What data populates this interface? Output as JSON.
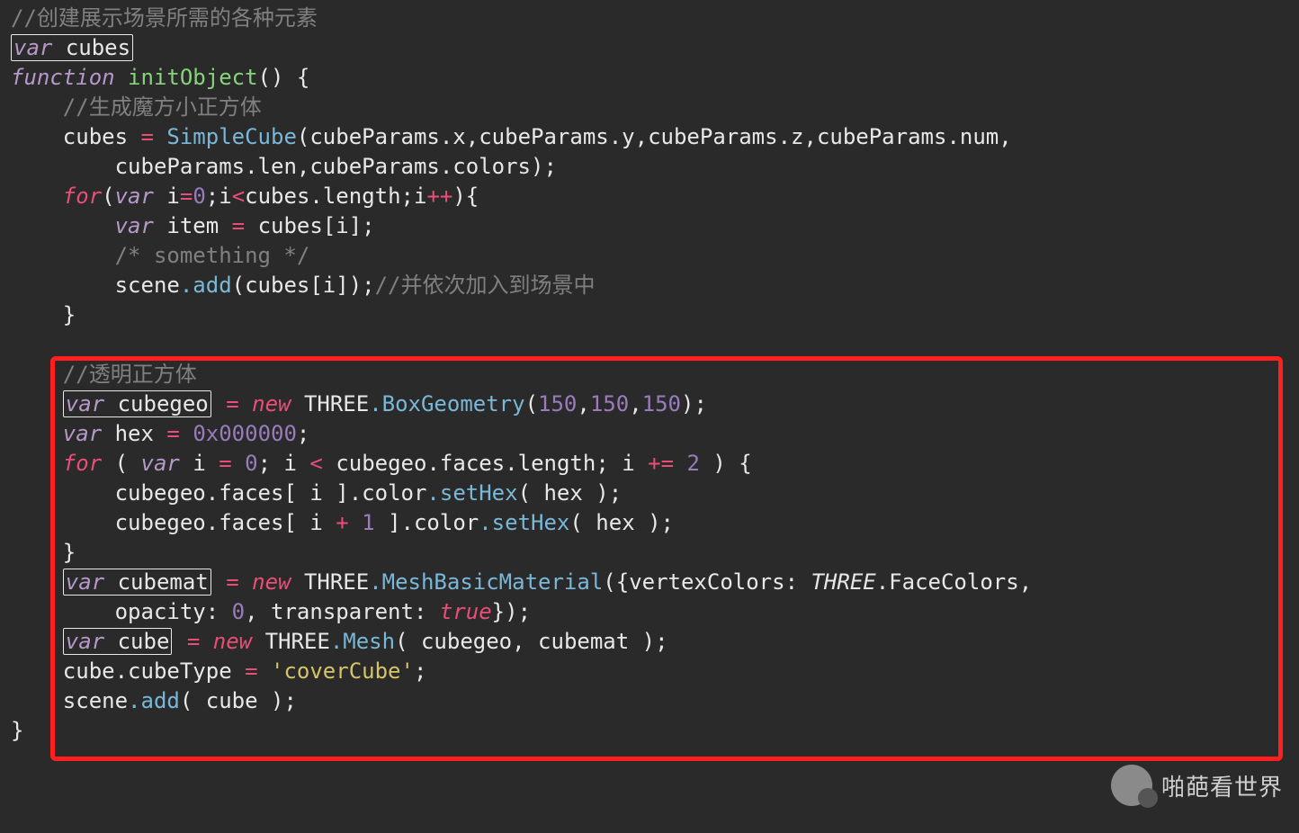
{
  "code": {
    "c1": "//创建展示场景所需的各种元素",
    "var": "var",
    "function": "function",
    "cubes": "cubes",
    "fnname": "initObject",
    "c2": "//生成魔方小正方体",
    "SimpleCube": "SimpleCube",
    "cubeParams": "cubeParams",
    "x": ".x",
    "y": ".y",
    "z": ".z",
    "num": ".num",
    "len": ".len",
    "colors": ".colors",
    "for": "for",
    "i": "i",
    "zero": "0",
    "length": ".length",
    "item": "item",
    "c3": "/* something */",
    "scene": "scene",
    "add": ".add",
    "c4": "//并依次加入到场景中",
    "c5": "//透明正方体",
    "cubegeo": "cubegeo",
    "new": "new",
    "THREE": "THREE",
    "BoxGeometry": ".BoxGeometry",
    "n150": "150",
    "hex": "hex",
    "hexval": "0x000000",
    "faces": ".faces",
    "color": ".color",
    "setHex": ".setHex",
    "plus2": "2",
    "one": "1",
    "cubemat": "cubemat",
    "MeshBasicMaterial": ".MeshBasicMaterial",
    "vertexColors": "vertexColors",
    "FaceColors": ".FaceColors",
    "opacity": "opacity",
    "transparent": "transparent",
    "true": "true",
    "cube": "cube",
    "Mesh": ".Mesh",
    "cubeType": ".cubeType",
    "coverCube": "'coverCube'",
    "plusplus": "++",
    "lt": "<",
    "eq": "=",
    "pluseq": "+=",
    "plus": "+"
  },
  "watermark": {
    "text": "啪葩看世界"
  }
}
